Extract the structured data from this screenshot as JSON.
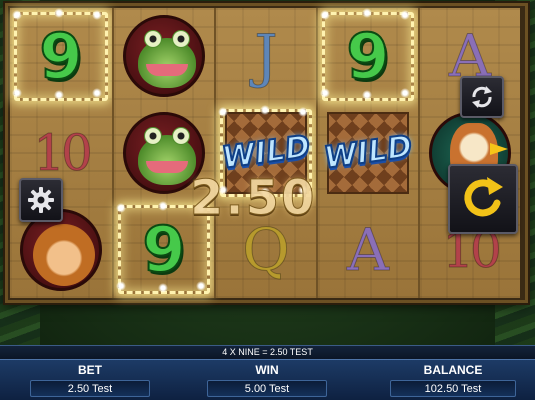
{
  "reels": [
    [
      {
        "type": "nine",
        "text": "9",
        "highlighted": true
      },
      {
        "type": "ten",
        "text": "10",
        "highlighted": false
      },
      {
        "type": "monkey",
        "text": "",
        "highlighted": false
      }
    ],
    [
      {
        "type": "frog",
        "text": "",
        "highlighted": false
      },
      {
        "type": "frog",
        "text": "",
        "highlighted": false
      },
      {
        "type": "nine",
        "text": "9",
        "highlighted": true
      }
    ],
    [
      {
        "type": "j",
        "text": "J",
        "highlighted": false
      },
      {
        "type": "wild",
        "text": "WILD",
        "highlighted": true
      },
      {
        "type": "q",
        "text": "Q",
        "highlighted": false
      }
    ],
    [
      {
        "type": "nine",
        "text": "9",
        "highlighted": true
      },
      {
        "type": "wild",
        "text": "WILD",
        "highlighted": false
      },
      {
        "type": "a",
        "text": "A",
        "highlighted": false
      }
    ],
    [
      {
        "type": "a",
        "text": "A",
        "highlighted": false
      },
      {
        "type": "bird",
        "text": "",
        "highlighted": false
      },
      {
        "type": "ten",
        "text": "10",
        "highlighted": false
      }
    ]
  ],
  "win_display": "2.50",
  "win_line_text": "4 X NINE = 2.50 TEST",
  "panel": {
    "bet_label": "BET",
    "bet_value": "2.50 Test",
    "win_label": "WIN",
    "win_value": "5.00 Test",
    "balance_label": "BALANCE",
    "balance_value": "102.50 Test"
  },
  "buttons": {
    "settings_icon": "gear-icon",
    "autoplay_icon": "refresh-icon",
    "spin_icon": "spin-arrow-icon"
  },
  "colors": {
    "highlight": "#fff3b0",
    "nine": "#46c94a",
    "panel": "#1d3b66",
    "spin_arrow": "#f2c218"
  }
}
